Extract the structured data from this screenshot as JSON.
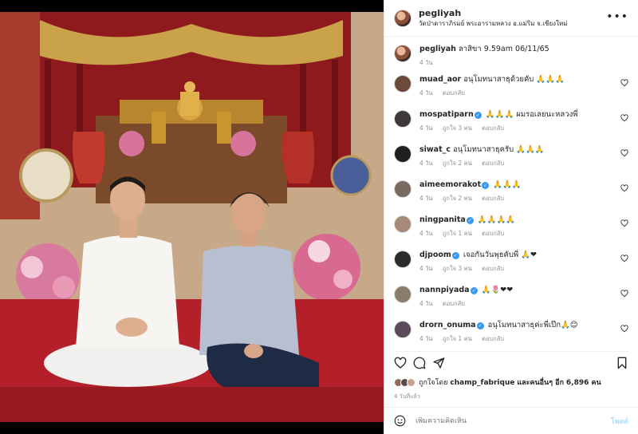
{
  "post": {
    "username": "pegliyah",
    "location": "วัดป่าดาราภิรมย์ พระอารามหลวง อ.แม่ริม จ.เชียงใหม่",
    "more_icon": "more-icon"
  },
  "caption": {
    "username": "pegliyah",
    "text": "ลาสิขา 9.59am 06/11/65",
    "time": "4 วัน"
  },
  "comments": [
    {
      "username": "muad_aor",
      "verified": false,
      "text": "อนุโมทนาสาธุด้วยคับ 🙏🙏🙏",
      "time": "4 วัน",
      "likes": "",
      "reply": "ตอบกลับ"
    },
    {
      "username": "mospatiparn",
      "verified": true,
      "text": "🙏🙏🙏 ผมรอเลยนะหลวงพี่",
      "time": "4 วัน",
      "likes": "ถูกใจ 3 คน",
      "reply": "ตอบกลับ"
    },
    {
      "username": "siwat_c",
      "verified": false,
      "text": "อนุโมทนาสาธุครับ 🙏🙏🙏",
      "time": "4 วัน",
      "likes": "ถูกใจ 2 คน",
      "reply": "ตอบกลับ"
    },
    {
      "username": "aimeemorakot",
      "verified": true,
      "text": "🙏🙏🙏",
      "time": "4 วัน",
      "likes": "ถูกใจ 2 คน",
      "reply": "ตอบกลับ"
    },
    {
      "username": "ningpanita",
      "verified": true,
      "text": "🙏🙏🙏🙏",
      "time": "4 วัน",
      "likes": "ถูกใจ 1 คน",
      "reply": "ตอบกลับ"
    },
    {
      "username": "djpoom",
      "verified": true,
      "text": "เจอกันวันพุธคับพี่ 🙏❤",
      "time": "4 วัน",
      "likes": "ถูกใจ 3 คน",
      "reply": "ตอบกลับ"
    },
    {
      "username": "nannpiyada",
      "verified": true,
      "text": "🙏🌷❤❤",
      "time": "4 วัน",
      "likes": "",
      "reply": "ตอบกลับ"
    },
    {
      "username": "drorn_onuma",
      "verified": true,
      "text": "อนุโมทนาสาธุค่ะพี่เป๊ก🙏😊",
      "time": "4 วัน",
      "likes": "ถูกใจ 1 คน",
      "reply": "ตอบกลับ"
    }
  ],
  "likes": {
    "prefix": "ถูกใจโดย",
    "user": "champ_fabrique",
    "middle": "และคนอื่นๆ อีก",
    "count": "6,896 คน"
  },
  "age": "4 วันที่แล้ว",
  "add_comment": {
    "placeholder": "เพิ่มความคิดเห็น",
    "post_label": "โพสต์"
  },
  "colors": {
    "verified": "#3897f0",
    "post_disabled": "#b2dffc",
    "muted": "#8e8e8e"
  }
}
